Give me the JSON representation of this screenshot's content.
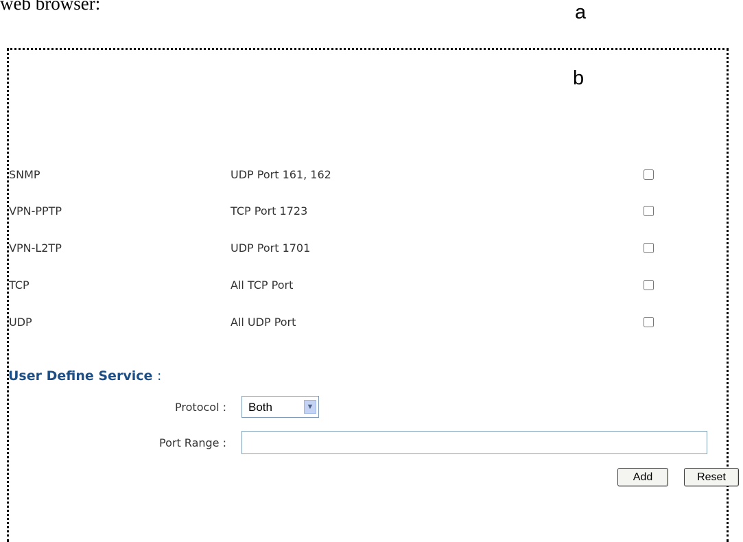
{
  "doc": {
    "intro_text": "web browser:",
    "marker_a": "a",
    "marker_b": "b"
  },
  "services": [
    {
      "name": "SNMP",
      "port": "UDP Port 161, 162",
      "checked": false
    },
    {
      "name": "VPN-PPTP",
      "port": "TCP Port 1723",
      "checked": false
    },
    {
      "name": "VPN-L2TP",
      "port": "UDP Port 1701",
      "checked": false
    },
    {
      "name": "TCP",
      "port": "All TCP Port",
      "checked": false
    },
    {
      "name": "UDP",
      "port": "All UDP Port",
      "checked": false
    }
  ],
  "user_define": {
    "title": "User Define Service",
    "title_colon": ":",
    "protocol_label": "Protocol :",
    "protocol_value": "Both",
    "port_range_label": "Port Range :",
    "port_range_value": ""
  },
  "buttons": {
    "add": "Add",
    "reset": "Reset"
  },
  "colors": {
    "section_title": "#1d4f86",
    "input_border": "#7f9db9"
  }
}
